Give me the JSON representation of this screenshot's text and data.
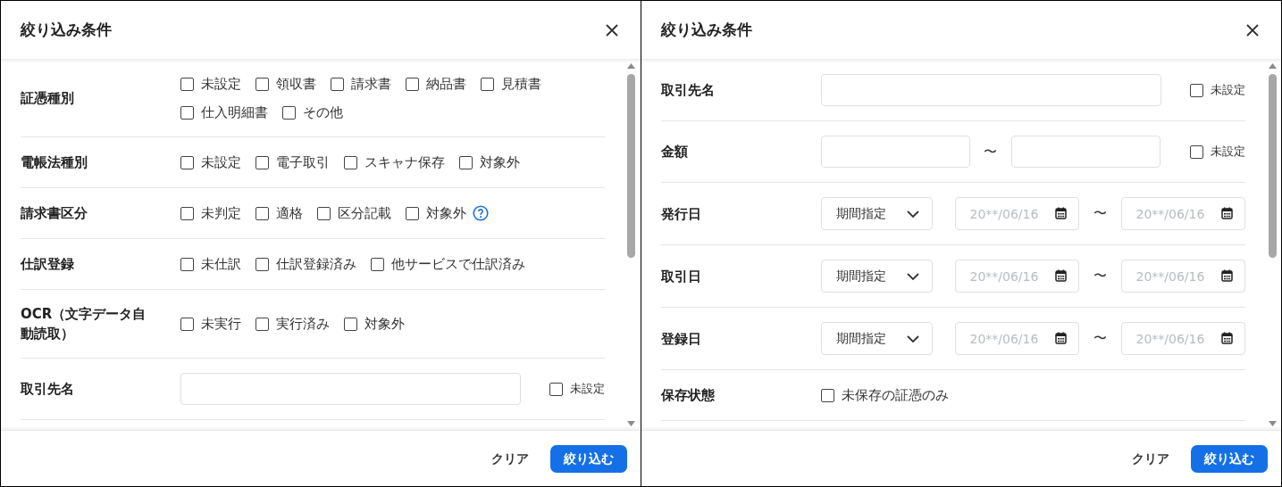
{
  "panels": [
    {
      "title": "絞り込み条件",
      "rows": [
        {
          "kind": "checkboxes",
          "label": "証憑種別",
          "options": [
            {
              "label": "未設定",
              "checked": false
            },
            {
              "label": "領収書",
              "checked": false
            },
            {
              "label": "請求書",
              "checked": false
            },
            {
              "label": "納品書",
              "checked": false
            },
            {
              "label": "見積書",
              "checked": false
            },
            {
              "label": "仕入明細書",
              "checked": false
            },
            {
              "label": "その他",
              "checked": false
            }
          ]
        },
        {
          "kind": "checkboxes",
          "label": "電帳法種別",
          "options": [
            {
              "label": "未設定",
              "checked": false
            },
            {
              "label": "電子取引",
              "checked": false
            },
            {
              "label": "スキャナ保存",
              "checked": false
            },
            {
              "label": "対象外",
              "checked": false
            }
          ]
        },
        {
          "kind": "checkboxes",
          "label": "請求書区分",
          "help": true,
          "options": [
            {
              "label": "未判定",
              "checked": false
            },
            {
              "label": "適格",
              "checked": false
            },
            {
              "label": "区分記載",
              "checked": false
            },
            {
              "label": "対象外",
              "checked": false
            }
          ]
        },
        {
          "kind": "checkboxes",
          "label": "仕訳登録",
          "options": [
            {
              "label": "未仕訳",
              "checked": false
            },
            {
              "label": "仕訳登録済み",
              "checked": false
            },
            {
              "label": "他サービスで仕訳済み",
              "checked": false
            }
          ]
        },
        {
          "kind": "checkboxes",
          "label": "OCR（文字データ自動読取）",
          "options": [
            {
              "label": "未実行",
              "checked": false
            },
            {
              "label": "実行済み",
              "checked": false
            },
            {
              "label": "対象外",
              "checked": false
            }
          ]
        },
        {
          "kind": "text",
          "label": "取引先名",
          "unset": {
            "label": "未設定",
            "checked": false
          }
        }
      ],
      "footer": {
        "clear": "クリア",
        "apply": "絞り込む"
      }
    },
    {
      "title": "絞り込み条件",
      "rows": [
        {
          "kind": "text",
          "label": "取引先名",
          "unset": {
            "label": "未設定",
            "checked": false
          }
        },
        {
          "kind": "range",
          "label": "金額",
          "separator": "〜",
          "unset": {
            "label": "未設定",
            "checked": false
          }
        },
        {
          "kind": "date",
          "label": "発行日",
          "select": "期間指定",
          "from": {
            "placeholder": "20**/06/16"
          },
          "separator": "〜",
          "to": {
            "placeholder": "20**/06/16"
          }
        },
        {
          "kind": "date",
          "label": "取引日",
          "select": "期間指定",
          "from": {
            "placeholder": "20**/06/16"
          },
          "separator": "〜",
          "to": {
            "placeholder": "20**/06/16"
          }
        },
        {
          "kind": "date",
          "label": "登録日",
          "select": "期間指定",
          "from": {
            "placeholder": "20**/06/16"
          },
          "separator": "〜",
          "to": {
            "placeholder": "20**/06/16"
          }
        },
        {
          "kind": "checkboxes",
          "label": "保存状態",
          "options": [
            {
              "label": "未保存の証憑のみ",
              "checked": false
            }
          ]
        }
      ],
      "footer": {
        "clear": "クリア",
        "apply": "絞り込む"
      }
    }
  ]
}
